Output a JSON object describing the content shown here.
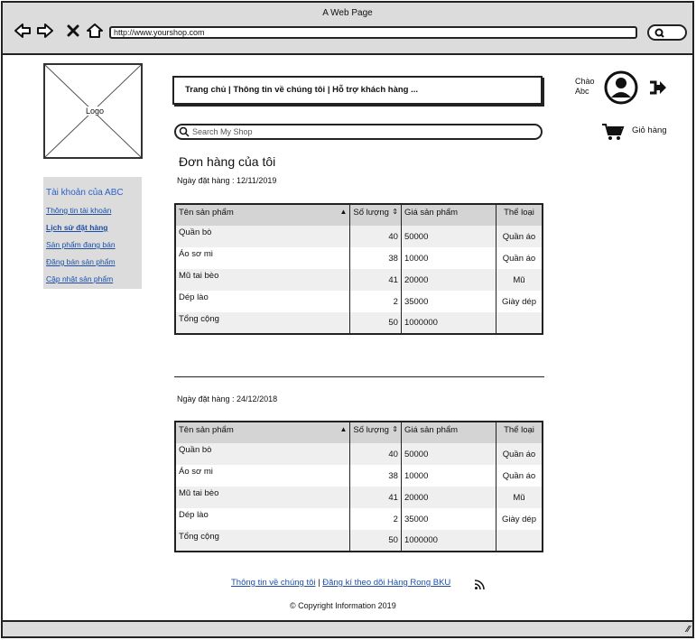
{
  "browser": {
    "title": "A Web Page",
    "url": "http://www.yourshop.com"
  },
  "logo": {
    "label": "Logo"
  },
  "sidebar": {
    "heading": "Tài khoản của ABC",
    "items": [
      {
        "label": "Thông tin tài khoản"
      },
      {
        "label": "Lịch sử đặt hàng"
      },
      {
        "label": "Sản phẩm đang bán"
      },
      {
        "label": "Đăng bán sản phẩm"
      },
      {
        "label": "Cập nhật sản phẩm"
      }
    ]
  },
  "topnav": {
    "text": "Trang chủ | Thông tin về chúng tôi | Hỗ trợ khách hàng     ..."
  },
  "search": {
    "placeholder": "Search My Shop"
  },
  "user": {
    "greeting": "Chào",
    "name": "Abc"
  },
  "cart": {
    "label": "Giỏ hàng"
  },
  "page": {
    "title": "Đơn hàng của tôi"
  },
  "columns": {
    "name": "Tên sản phẩm",
    "qty": "Số lượng",
    "price": "Giá sản phẩm",
    "category": "Thể loại"
  },
  "orders": [
    {
      "date": "Ngày đặt hàng : 12/11/2019",
      "rows": [
        {
          "name": "Quần bò",
          "qty": "40",
          "price": "50000",
          "category": "Quần áo"
        },
        {
          "name": "Áo sơ mi",
          "qty": "38",
          "price": "10000",
          "category": "Quần áo"
        },
        {
          "name": "Mũ tai bèo",
          "qty": "41",
          "price": "20000",
          "category": "Mũ"
        },
        {
          "name": "Dép lào",
          "qty": "2",
          "price": "35000",
          "category": "Giày dép"
        },
        {
          "name": "Tổng cộng",
          "qty": "50",
          "price": "1000000",
          "category": ""
        }
      ]
    },
    {
      "date": "Ngày đặt hàng : 24/12/2018",
      "rows": [
        {
          "name": "Quần bò",
          "qty": "40",
          "price": "50000",
          "category": "Quần áo"
        },
        {
          "name": "Áo sơ mi",
          "qty": "38",
          "price": "10000",
          "category": "Quần áo"
        },
        {
          "name": "Mũ tai bèo",
          "qty": "41",
          "price": "20000",
          "category": "Mũ"
        },
        {
          "name": "Dép lào",
          "qty": "2",
          "price": "35000",
          "category": "Giày dép"
        },
        {
          "name": "Tổng cộng",
          "qty": "50",
          "price": "1000000",
          "category": ""
        }
      ]
    }
  ],
  "footer": {
    "link_about": "Thông tin về chúng tôi",
    "separator": "|",
    "link_subscribe": "Đăng kí theo dõi Hàng Rong BKU",
    "copyright": "© Copyright Information 2019"
  }
}
